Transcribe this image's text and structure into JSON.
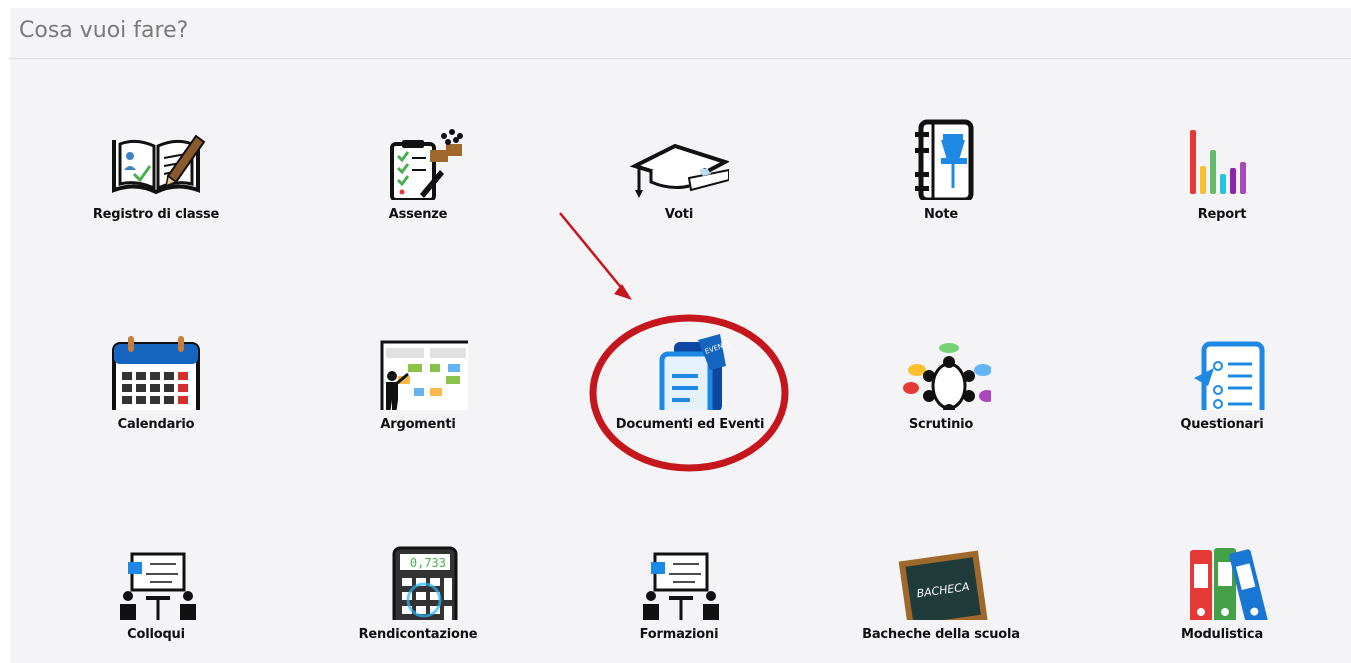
{
  "header": {
    "title": "Cosa vuoi fare?"
  },
  "tiles": [
    {
      "label": "Registro di classe",
      "icon": "open-book-pencil-icon"
    },
    {
      "label": "Assenze",
      "icon": "clipboard-checklist-icon"
    },
    {
      "label": "Voti",
      "icon": "graduation-cap-icon"
    },
    {
      "label": "Note",
      "icon": "notebook-pin-icon"
    },
    {
      "label": "Report",
      "icon": "bar-chart-icon"
    },
    {
      "label": "Calendario",
      "icon": "calendar-icon"
    },
    {
      "label": "Argomenti",
      "icon": "teacher-blackboard-icon"
    },
    {
      "label": "Documenti ed Eventi",
      "icon": "documents-events-icon"
    },
    {
      "label": "Scrutinio",
      "icon": "meeting-table-icon"
    },
    {
      "label": "Questionari",
      "icon": "questionnaire-icon"
    },
    {
      "label": "Colloqui",
      "icon": "conversation-board-icon"
    },
    {
      "label": "Rendicontazione",
      "icon": "calculator-icon"
    },
    {
      "label": "Formazioni",
      "icon": "training-board-icon"
    },
    {
      "label": "Bacheche della scuola",
      "icon": "chalkboard-icon"
    },
    {
      "label": "Modulistica",
      "icon": "binders-icon"
    }
  ],
  "icon_text": {
    "calculator_display": "0,733",
    "chalkboard_text": "BACHECA",
    "documents_tag": "EVENTI"
  },
  "annotation": {
    "highlight_color": "#c4161c"
  }
}
